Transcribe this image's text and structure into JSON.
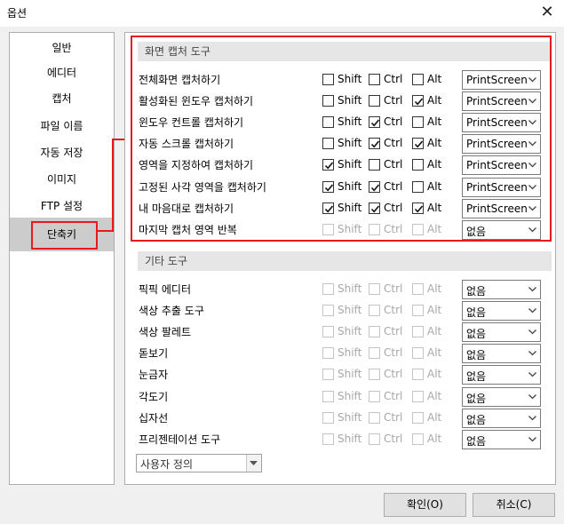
{
  "window": {
    "title": "옵션",
    "close_icon": "close-icon"
  },
  "sidebar": {
    "items": [
      {
        "label": "일반"
      },
      {
        "label": "에디터"
      },
      {
        "label": "캡처"
      },
      {
        "label": "파일 이름"
      },
      {
        "label": "자동 저장"
      },
      {
        "label": "이미지"
      },
      {
        "label": "FTP 설정"
      },
      {
        "label": "단축키"
      }
    ],
    "active": "단축키"
  },
  "capture_tools": {
    "header": "화면 캡처 도구",
    "rows": [
      {
        "label": "전체화면 캡처하기",
        "shift": false,
        "ctrl": false,
        "alt": false,
        "key": "PrintScreen",
        "enabled": true
      },
      {
        "label": "활성화된 윈도우 캡처하기",
        "shift": false,
        "ctrl": false,
        "alt": true,
        "key": "PrintScreen",
        "enabled": true
      },
      {
        "label": "윈도우 컨트롤 캡처하기",
        "shift": false,
        "ctrl": true,
        "alt": false,
        "key": "PrintScreen",
        "enabled": true
      },
      {
        "label": "자동 스크롤 캡처하기",
        "shift": false,
        "ctrl": true,
        "alt": true,
        "key": "PrintScreen",
        "enabled": true
      },
      {
        "label": "영역을 지정하여 캡처하기",
        "shift": true,
        "ctrl": false,
        "alt": false,
        "key": "PrintScreen",
        "enabled": true
      },
      {
        "label": "고정된 사각 영역을 캡처하기",
        "shift": true,
        "ctrl": true,
        "alt": false,
        "key": "PrintScreen",
        "enabled": true
      },
      {
        "label": "내 마음대로 캡처하기",
        "shift": true,
        "ctrl": true,
        "alt": true,
        "key": "PrintScreen",
        "enabled": true
      },
      {
        "label": "마지막 캡처 영역 반복",
        "shift": false,
        "ctrl": false,
        "alt": false,
        "key": "없음",
        "enabled": false
      }
    ]
  },
  "other_tools": {
    "header": "기타 도구",
    "rows": [
      {
        "label": "픽픽 에디터",
        "shift": false,
        "ctrl": false,
        "alt": false,
        "key": "없음",
        "enabled": false
      },
      {
        "label": "색상 추출 도구",
        "shift": false,
        "ctrl": false,
        "alt": false,
        "key": "없음",
        "enabled": false
      },
      {
        "label": "색상 팔레트",
        "shift": false,
        "ctrl": false,
        "alt": false,
        "key": "없음",
        "enabled": false
      },
      {
        "label": "돋보기",
        "shift": false,
        "ctrl": false,
        "alt": false,
        "key": "없음",
        "enabled": false
      },
      {
        "label": "눈금자",
        "shift": false,
        "ctrl": false,
        "alt": false,
        "key": "없음",
        "enabled": false
      },
      {
        "label": "각도기",
        "shift": false,
        "ctrl": false,
        "alt": false,
        "key": "없음",
        "enabled": false
      },
      {
        "label": "십자선",
        "shift": false,
        "ctrl": false,
        "alt": false,
        "key": "없음",
        "enabled": false
      },
      {
        "label": "프리젠테이션 도구",
        "shift": false,
        "ctrl": false,
        "alt": false,
        "key": "없음",
        "enabled": false
      }
    ]
  },
  "modifiers": {
    "shift": "Shift",
    "ctrl": "Ctrl",
    "alt": "Alt"
  },
  "preset": {
    "value": "사용자 정의"
  },
  "buttons": {
    "ok": "확인(O)",
    "cancel": "취소(C)"
  },
  "colors": {
    "highlight": "#e8191a",
    "active_tab": "#cccccc",
    "section_header": "#e6e6e6"
  }
}
